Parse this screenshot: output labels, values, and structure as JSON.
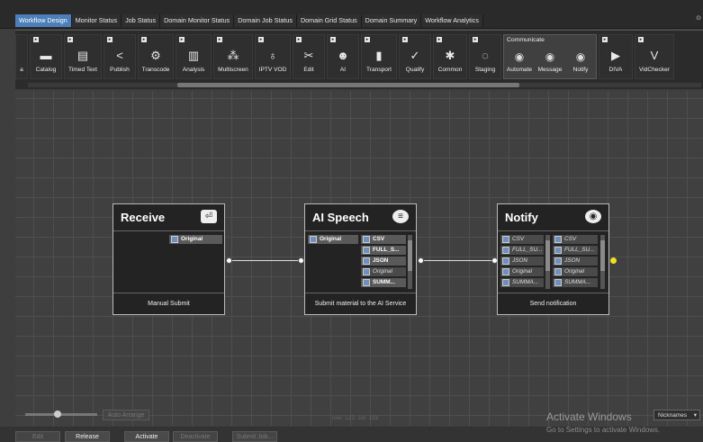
{
  "tabs": [
    "Workflow Design",
    "Monitor Status",
    "Job Status",
    "Domain Monitor Status",
    "Domain Job Status",
    "Domain Grid Status",
    "Domain Summary",
    "Workflow Analytics"
  ],
  "tab_right": "⊙",
  "ribbon": {
    "tools_left": [
      {
        "label": "a",
        "icon": "partial-icon"
      },
      {
        "label": "Catalog",
        "icon": "folder-icon"
      },
      {
        "label": "Timed Text",
        "icon": "document-icon"
      },
      {
        "label": "Publish",
        "icon": "share-icon"
      },
      {
        "label": "Transcode",
        "icon": "gear-icon"
      },
      {
        "label": "Analysis",
        "icon": "barcode-icon"
      },
      {
        "label": "Multiscreen",
        "icon": "nodes-icon"
      },
      {
        "label": "IPTV VOD",
        "icon": "network-icon"
      },
      {
        "label": "Edit",
        "icon": "scissors-icon"
      },
      {
        "label": "AI",
        "icon": "head-icon"
      },
      {
        "label": "Transport",
        "icon": "file-icon"
      },
      {
        "label": "Qualify",
        "icon": "check-circle-icon"
      },
      {
        "label": "Common",
        "icon": "puzzle-icon"
      },
      {
        "label": "Staging",
        "icon": "dotted-circle-icon"
      }
    ],
    "group": {
      "title": "Communicate",
      "items": [
        "Automate",
        "Message",
        "Notify"
      ]
    },
    "tools_right": [
      {
        "label": "DIVA",
        "icon": "play-icon"
      },
      {
        "label": "VidChecker",
        "icon": "v-icon"
      }
    ]
  },
  "nodes": {
    "receive": {
      "title": "Receive",
      "footer": "Manual Submit",
      "outputs": [
        "Original"
      ]
    },
    "ai_speech": {
      "title": "AI Speech",
      "footer": "Submit material to the AI Service",
      "inputs": [
        "Original"
      ],
      "outputs": [
        "CSV",
        "FULL_S...",
        "JSON",
        "Original",
        "SUMM..."
      ]
    },
    "notify": {
      "title": "Notify",
      "footer": "Send notification",
      "inputs": [
        "CSV",
        "FULL_SU...",
        "JSON",
        "Original",
        "SUMMA..."
      ],
      "outputs": [
        "CSV",
        "FULL_SU...",
        "JSON",
        "Original",
        "SUMMA..."
      ]
    }
  },
  "controls": {
    "auto_arrange": "Auto Arrange",
    "edit": "Edit",
    "release": "Release",
    "activate": "Activate",
    "deactivate": "Deactivate",
    "submit_job": "Submit Job...",
    "status_center": "row: 122, col: 183",
    "nicknames": "Nicknames"
  },
  "watermark": {
    "line1": "Activate Windows",
    "line2": "Go to Settings to activate Windows."
  },
  "colors": {
    "active_tab": "#4c7fb9",
    "port_icon": "#6f8fbf",
    "output_dot": "#f0e020"
  }
}
